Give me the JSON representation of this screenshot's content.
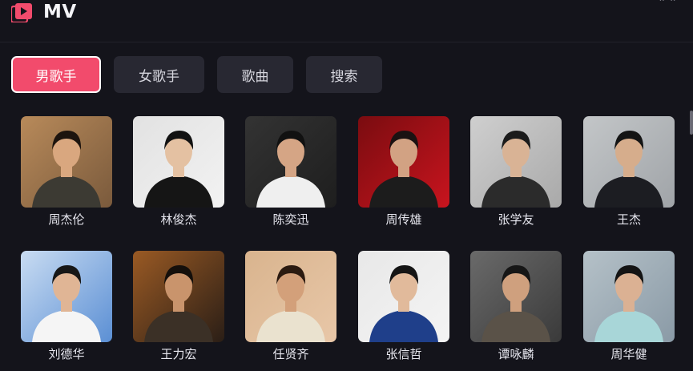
{
  "header": {
    "title": "MV",
    "logo_icon": "video-play-icon",
    "accent": "#f24b6c"
  },
  "tabs": [
    {
      "label": "男歌手",
      "active": true
    },
    {
      "label": "女歌手",
      "active": false
    },
    {
      "label": "歌曲",
      "active": false
    },
    {
      "label": "搜索",
      "active": false
    }
  ],
  "artists": [
    {
      "name": "周杰伦",
      "bg": "#7a5a3c",
      "bg2": "#b88a5a",
      "skin": "#d9a77f",
      "hair": "#1d140e",
      "shirt": "#3c3a33"
    },
    {
      "name": "林俊杰",
      "bg": "#f2f2f2",
      "bg2": "#e2e2e2",
      "skin": "#e4c1a2",
      "hair": "#121212",
      "shirt": "#151515"
    },
    {
      "name": "陈奕迅",
      "bg": "#1e1e1e",
      "bg2": "#333333",
      "skin": "#d5a585",
      "hair": "#111111",
      "shirt": "#efefef"
    },
    {
      "name": "周传雄",
      "bg": "#c8141e",
      "bg2": "#7a0c10",
      "skin": "#d2a283",
      "hair": "#1a1212",
      "shirt": "#1c1c1c"
    },
    {
      "name": "张学友",
      "bg": "#a9a9a9",
      "bg2": "#cfcfcf",
      "skin": "#d9b395",
      "hair": "#1b1b1b",
      "shirt": "#2b2b2b"
    },
    {
      "name": "王杰",
      "bg": "#a0a4a8",
      "bg2": "#c3c6c8",
      "skin": "#d6ad8c",
      "hair": "#141414",
      "shirt": "#1c1d22"
    },
    {
      "name": "刘德华",
      "bg": "#5b8fd4",
      "bg2": "#c9dcf2",
      "skin": "#e0b595",
      "hair": "#171717",
      "shirt": "#f5f5f5"
    },
    {
      "name": "王力宏",
      "bg": "#2a1e16",
      "bg2": "#9a5a24",
      "skin": "#c9946c",
      "hair": "#140f0b",
      "shirt": "#3b3026"
    },
    {
      "name": "任贤齐",
      "bg": "#e8c7a8",
      "bg2": "#d9b48e",
      "skin": "#d3a07a",
      "hair": "#2b1a10",
      "shirt": "#eae2cf"
    },
    {
      "name": "张信哲",
      "bg": "#f4f4f4",
      "bg2": "#e8e8e8",
      "skin": "#e1ba9b",
      "hair": "#151515",
      "shirt": "#1f3f8a"
    },
    {
      "name": "谭咏麟",
      "bg": "#3a3a3a",
      "bg2": "#6a6a6a",
      "skin": "#cfa07e",
      "hair": "#161616",
      "shirt": "#5a5248"
    },
    {
      "name": "周华健",
      "bg": "#8a9aa6",
      "bg2": "#b5c1c8",
      "skin": "#dbb193",
      "hair": "#141414",
      "shirt": "#a8d6d8"
    }
  ]
}
